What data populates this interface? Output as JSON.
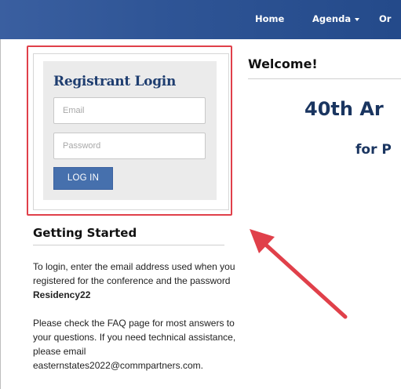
{
  "nav": {
    "home": "Home",
    "agenda": "Agenda",
    "overflow": "Or"
  },
  "login": {
    "title": "Registrant Login",
    "email_placeholder": "Email",
    "password_placeholder": "Password",
    "button_label": "LOG IN"
  },
  "getting_started": {
    "title": "Getting Started",
    "para1_text": "To login, enter the email address used when you registered for the conference and the password ",
    "para1_password": "Residency22",
    "para2_text": "Please check the FAQ page for most answers to your questions. If you need technical assistance, please email easternstates2022@commpartners.com."
  },
  "main": {
    "welcome": "Welcome!",
    "hero_line1": "40th Ar",
    "hero_line2": "for P"
  },
  "annotation": {
    "highlight_color": "#e0404a",
    "arrow_color": "#e0404a"
  },
  "colors": {
    "navbar": "#2f5596",
    "button": "#4670ad",
    "heading_blue": "#1f3e70"
  }
}
